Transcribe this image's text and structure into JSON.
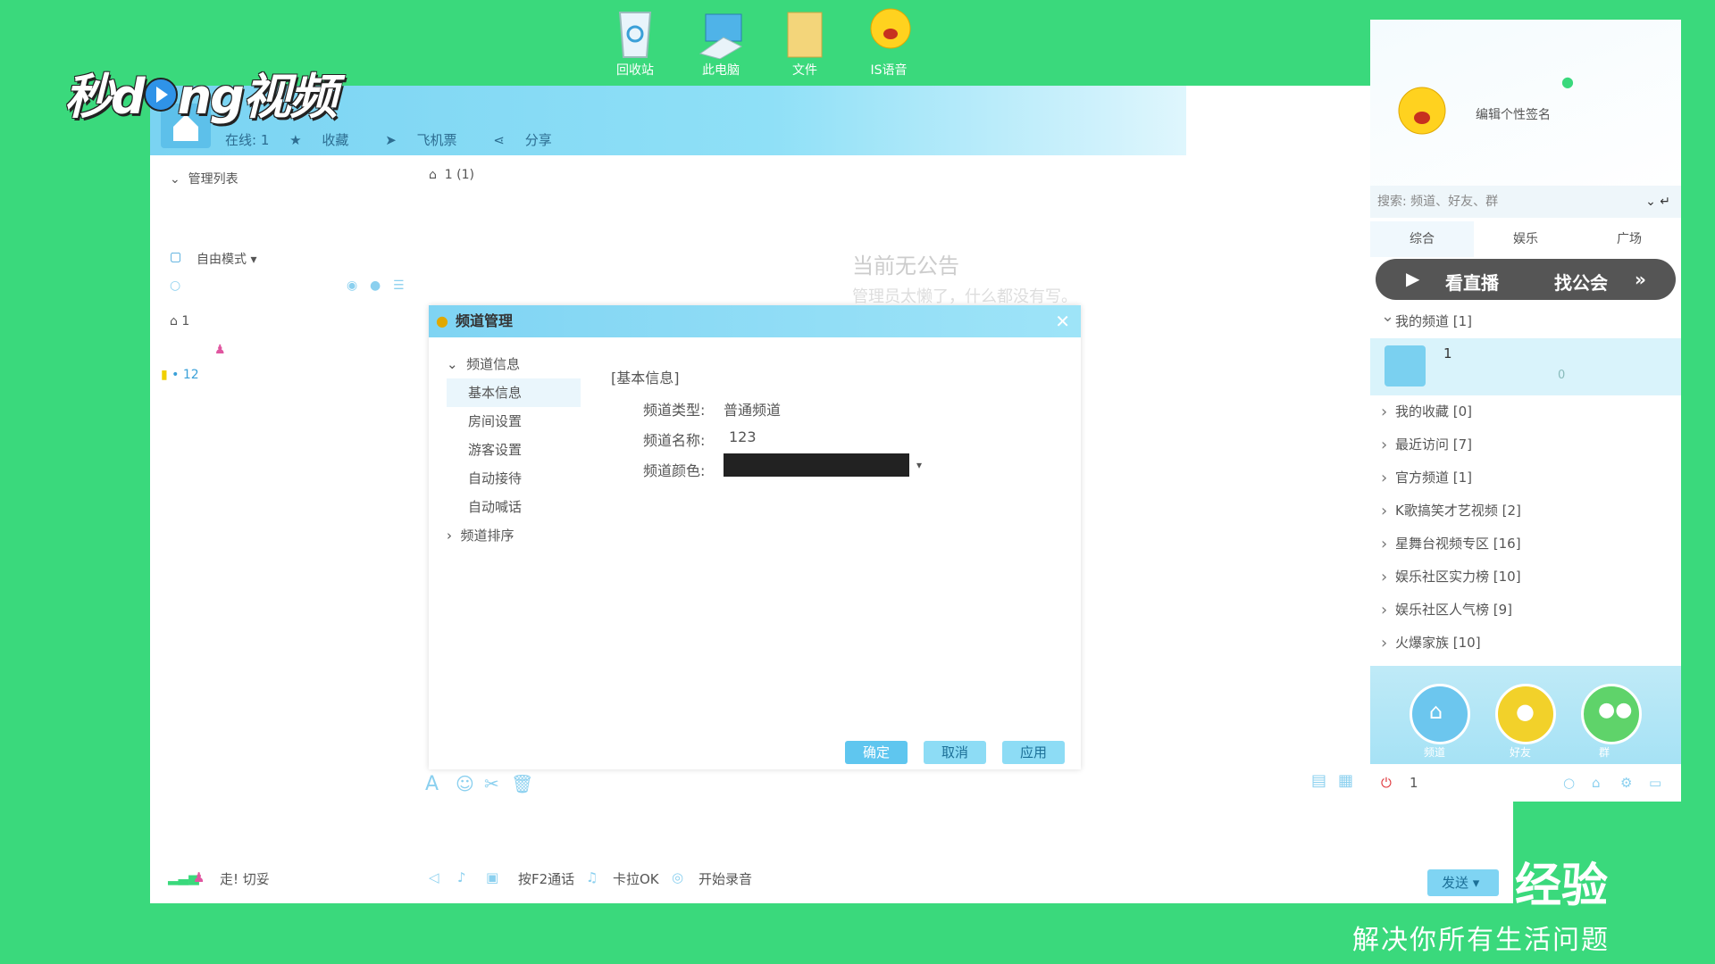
{
  "desktop": {
    "icons": [
      {
        "label": "回收站",
        "icon": "recycle-bin-icon"
      },
      {
        "label": "此电脑",
        "icon": "computer-icon"
      },
      {
        "label": "文件",
        "icon": "folder-icon"
      },
      {
        "label": "IS语音",
        "icon": "is-voice-icon"
      }
    ]
  },
  "watermark": {
    "logo_left": "秒d",
    "logo_right": "ng视频",
    "jingyan": "经验",
    "slogan": "解决你所有生活问题"
  },
  "topbar": {
    "online_label": "在线: 1",
    "favorite": "收藏",
    "ticket": "飞机票",
    "share": "分享"
  },
  "left_pane": {
    "manage_list": "管理列表",
    "mode": "自由模式",
    "channel_root": "1",
    "sub_channel": "12"
  },
  "breadcrumb": "1 (1)",
  "notice": {
    "title": "当前无公告",
    "subtitle": "管理员太懒了，什么都没有写。"
  },
  "dialog": {
    "title": "频道管理",
    "tree": {
      "group": "频道信息",
      "items": [
        "基本信息",
        "房间设置",
        "游客设置",
        "自动接待",
        "自动喊话"
      ],
      "group2": "频道排序"
    },
    "section": "[基本信息]",
    "type_label": "频道类型:",
    "type_value": "普通频道",
    "name_label": "频道名称:",
    "name_value": "123",
    "color_label": "频道颜色:",
    "color_value": "#222222",
    "buttons": {
      "ok": "确定",
      "cancel": "取消",
      "apply": "应用"
    }
  },
  "bottom": {
    "status": "走! 切妥",
    "f2_talk": "按F2通话",
    "karaoke": "卡拉OK",
    "record": "开始录音",
    "send": "发送",
    "power_count": "1"
  },
  "right_panel": {
    "signature": "编辑个性签名",
    "search_placeholder": "搜索: 频道、好友、群",
    "tabs": [
      "综合",
      "娱乐",
      "广场"
    ],
    "live": "看直播",
    "guild": "找公会",
    "my_channels": "我的频道 [1]",
    "my_channel_name": "1",
    "my_channel_users": "0",
    "list": [
      "我的收藏 [0]",
      "最近访问 [7]",
      "官方频道 [1]",
      "K歌搞笑才艺视频 [2]",
      "星舞台视频专区 [16]",
      "娱乐社区实力榜 [10]",
      "娱乐社区人气榜 [9]",
      "火爆家族 [10]"
    ],
    "bottom_tabs": [
      "频道",
      "好友",
      "群"
    ]
  }
}
